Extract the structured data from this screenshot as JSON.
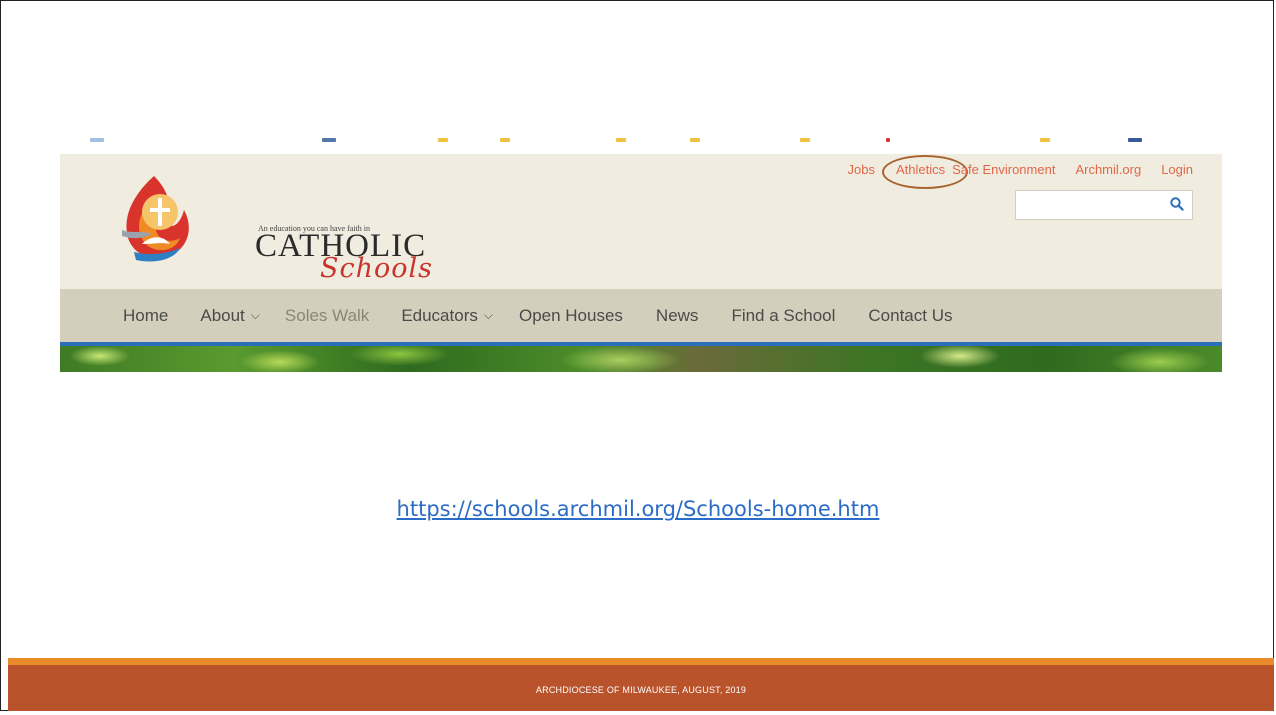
{
  "site": {
    "logo": {
      "tagline": "An education you can have faith in",
      "wordmark": "CATHOLIC",
      "script": "Schools"
    },
    "utility_nav": [
      {
        "label": "Jobs",
        "circled": false
      },
      {
        "label": "Athletics",
        "circled": true
      },
      {
        "label": "Safe Environment",
        "circled": false
      },
      {
        "label": "Archmil.org",
        "circled": false
      },
      {
        "label": "Login",
        "circled": false
      }
    ],
    "search": {
      "value": "",
      "icon": "search-icon"
    },
    "main_nav": [
      {
        "label": "Home",
        "has_dropdown": false,
        "muted": false
      },
      {
        "label": "About",
        "has_dropdown": true,
        "muted": false
      },
      {
        "label": "Soles Walk",
        "has_dropdown": false,
        "muted": true
      },
      {
        "label": "Educators",
        "has_dropdown": true,
        "muted": false
      },
      {
        "label": "Open Houses",
        "has_dropdown": false,
        "muted": false
      },
      {
        "label": "News",
        "has_dropdown": false,
        "muted": false
      },
      {
        "label": "Find a School",
        "has_dropdown": false,
        "muted": false
      },
      {
        "label": "Contact Us",
        "has_dropdown": false,
        "muted": false
      }
    ]
  },
  "slide": {
    "url": "https://schools.archmil.org/Schools-home.htm",
    "footer": "ARCHDIOCESE OF MILWAUKEE, AUGUST, 2019"
  },
  "colors": {
    "utility_link": "#e16748",
    "nav_underline": "#2a6fb8",
    "footer_bg": "#b9532b",
    "footer_accent": "#e98b2a",
    "url_link": "#2b6cc7"
  }
}
